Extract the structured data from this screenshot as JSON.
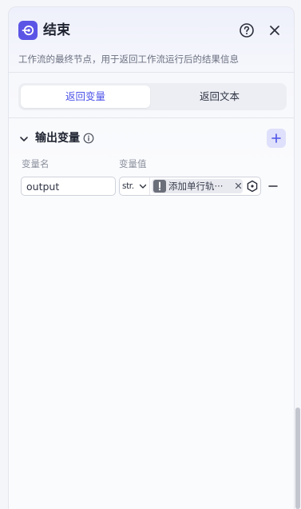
{
  "node": {
    "title": "结束",
    "description": "工作流的最终节点，用于返回工作流运行后的结果信息",
    "icon": "end-node-icon",
    "accent": "#5b55e6"
  },
  "header": {
    "help_icon": "question-circle-icon",
    "close_icon": "close-icon"
  },
  "tabs": [
    {
      "label": "返回变量",
      "active": true
    },
    {
      "label": "返回文本",
      "active": false
    }
  ],
  "output_section": {
    "title": "输出变量",
    "info_icon": "info-circle-icon",
    "add_icon": "plus-icon",
    "columns": {
      "name": "变量名",
      "value": "变量值"
    },
    "rows": [
      {
        "name": "output",
        "type": "str.",
        "ref_label": "添加单行轨···",
        "warn_icon": "exclamation-icon",
        "picker_icon": "variable-picker-icon",
        "remove_icon": "minus-icon"
      }
    ]
  },
  "colors": {
    "active_tab_text": "#4d53e8",
    "add_button_bg": "#dfe0fb"
  }
}
